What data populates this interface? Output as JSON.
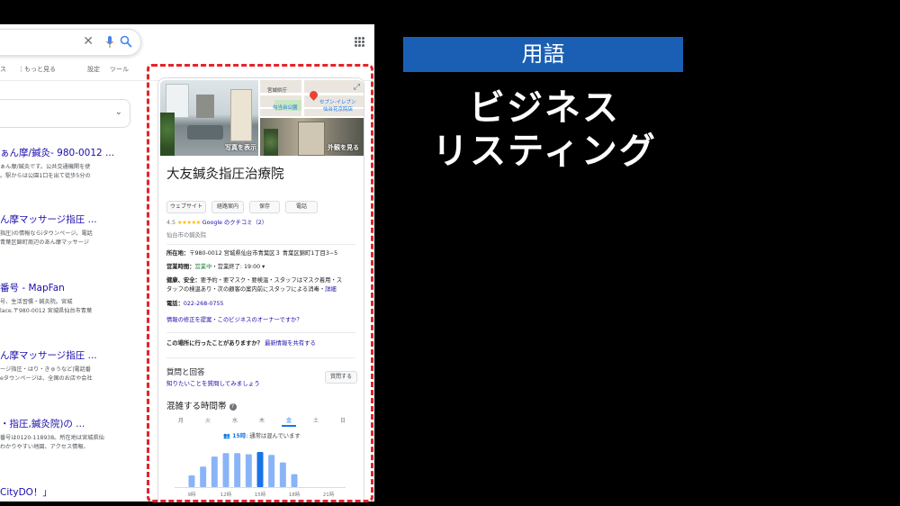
{
  "browser": {
    "tabs": {
      "partial_tab": "ス",
      "more": "⋮もっと見る",
      "settings": "設定",
      "tools": "ツール"
    },
    "results": [
      {
        "title": "ぁん摩/鍼灸- 980-0012 ...",
        "snippets": [
          "ぁん摩/鍼灸です。公共交通機関を使",
          "。駅からは公園1口を出て徒歩5分の"
        ]
      },
      {
        "title": "ん摩マッサージ指圧 ...",
        "snippets": [
          "指圧)の情報ならiタウンページ。電話",
          "青葉区錦町周辺のあん摩マッサージ"
        ]
      },
      {
        "title": "番号 - MapFan",
        "snippets": [
          "号、生活習慣・鍼灸院。宮城",
          "lace.〒980-0012 宮城県仙台市青葉"
        ]
      },
      {
        "title": "ん摩マッサージ指圧 ...",
        "snippets": [
          "ージ指圧・はり・きゅうなど|電話番",
          "eタウンページは、全国のお店や会社"
        ]
      },
      {
        "title": "・指圧,鍼灸院)の ...",
        "snippets": [
          "番号は0120-118938。所在地は宮城県仙",
          "わかりやすい地図、アクセス情報、"
        ]
      },
      {
        "title": "CityDO！」",
        "snippets": []
      }
    ]
  },
  "knowledge_panel": {
    "photo_left_label": "写真を表示",
    "photo_right_label": "外観を見る",
    "map_labels": {
      "prefecture_office": "宮城県庁",
      "park": "勾当台公園",
      "store": "セブン-イレブン",
      "store_branch": "仙台花京院店"
    },
    "business_name": "大友鍼灸指圧治療院",
    "buttons": [
      "ウェブサイト",
      "経路案内",
      "保存",
      "電話"
    ],
    "rating": "4.5",
    "stars": "★★★★★",
    "reviews_link": "Google のクチコミ（2）",
    "category": "仙台市の鍼灸院",
    "address_label": "所在地：",
    "address": "〒980-0012 宮城県仙台市青葉区３ 青葉区錦町1丁目3−5",
    "hours_label": "営業時間：",
    "hours_open": "営業中",
    "hours_rest": "・営業終了: 19:00 ▾",
    "health_label": "健康、安全：",
    "health_line1": "要予約・要マスク・要検温・スタッフはマスク着用・ス",
    "health_line2": "タッフの検温あり・次の顧客の案内前にスタッフによる消毒・",
    "health_more": "詳細",
    "phone_label": "電話：",
    "phone": "022-268-0755",
    "suggest_edit": "情報の修正を提案・このビジネスのオーナーですか？",
    "visited_question": "この場所に行ったことがありますか？",
    "share_link": "最新情報を共有する",
    "qa_title": "質問と回答",
    "qa_link": "知りたいことを質問してみましょう",
    "ask_button": "質問する",
    "popular_title": "混雑する時間帯",
    "days": [
      "月",
      "火",
      "水",
      "木",
      "金",
      "土",
      "日"
    ],
    "selected_day": "金",
    "now_time": "15時",
    "now_status": ": 通常は混んでいます"
  },
  "chart_data": {
    "type": "bar",
    "title": "混雑する時間帯",
    "x_tick_labels": [
      "9時",
      "12時",
      "15時",
      "18時",
      "21時"
    ],
    "categories": [
      "8",
      "9",
      "10",
      "11",
      "12",
      "13",
      "14",
      "15",
      "16",
      "17",
      "18",
      "19",
      "20",
      "21",
      "22"
    ],
    "values": [
      0,
      20,
      35,
      52,
      58,
      58,
      56,
      60,
      55,
      42,
      22,
      0,
      0,
      0,
      0
    ],
    "highlight_category": "15",
    "ylim": [
      0,
      100
    ],
    "colors": {
      "bar": "#8ab4f8",
      "highlight": "#1a73e8"
    }
  },
  "slide": {
    "tag": "用語",
    "title_line1": "ビジネス",
    "title_line2": "リスティング",
    "tag_color": "#1a5fb4",
    "frame_color": "#e3242b"
  }
}
